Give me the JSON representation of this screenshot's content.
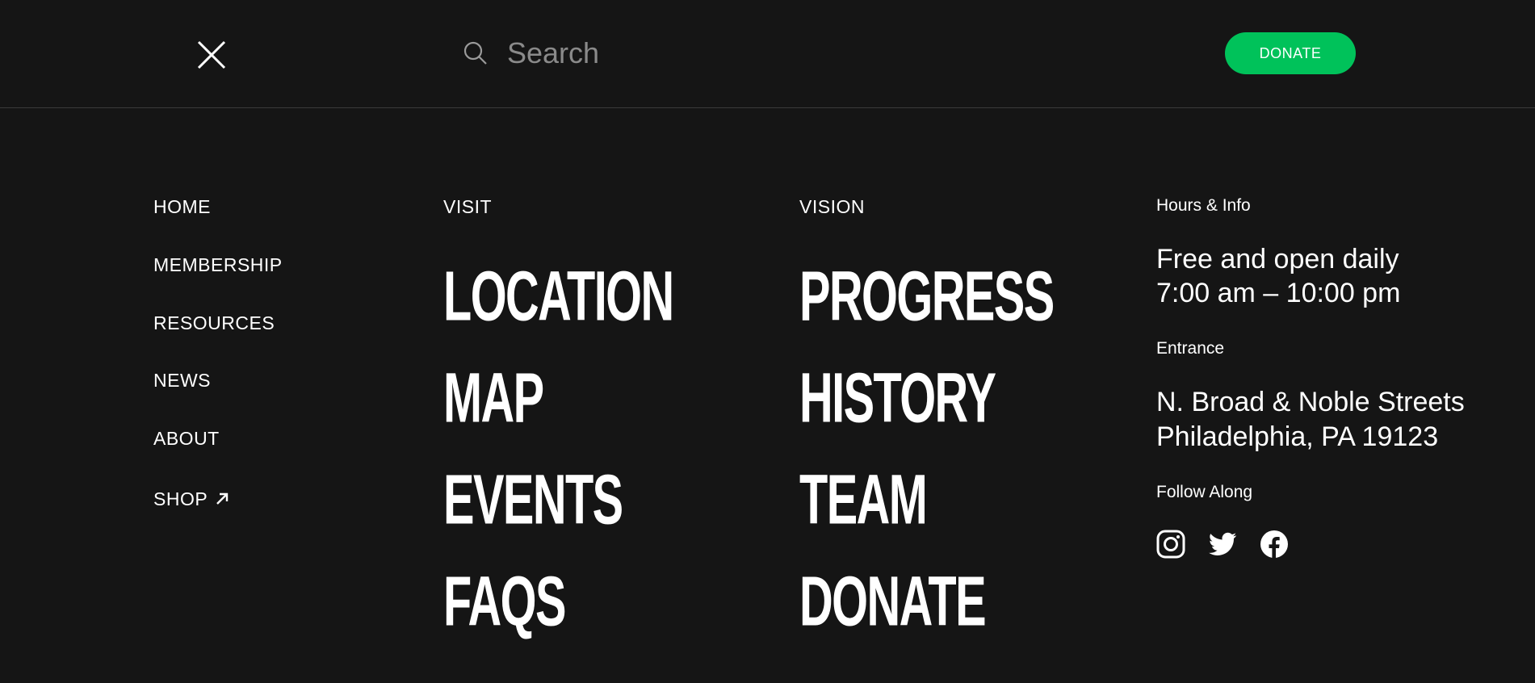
{
  "topbar": {
    "search": {
      "placeholder": "Search",
      "value": ""
    },
    "donate_label": "DONATE",
    "accent_color": "#00c25a"
  },
  "left_nav": {
    "items": [
      {
        "label": "HOME"
      },
      {
        "label": "MEMBERSHIP"
      },
      {
        "label": "RESOURCES"
      },
      {
        "label": "NEWS"
      },
      {
        "label": "ABOUT"
      },
      {
        "label": "SHOP",
        "icon": "external-arrow-icon"
      }
    ]
  },
  "visit": {
    "heading": "VISIT",
    "links": [
      "LOCATION",
      "MAP",
      "EVENTS",
      "FAQS"
    ]
  },
  "vision": {
    "heading": "VISION",
    "links": [
      "PROGRESS",
      "HISTORY",
      "TEAM",
      "DONATE"
    ]
  },
  "info": {
    "hours_heading": "Hours & Info",
    "hours_line1": "Free and open daily",
    "hours_line2": "7:00 am – 10:00 pm",
    "entrance_heading": "Entrance",
    "address_line1": "N. Broad & Noble Streets",
    "address_line2": "Philadelphia, PA 19123",
    "follow_heading": "Follow Along",
    "social_icons": [
      "instagram-icon",
      "twitter-icon",
      "facebook-icon"
    ]
  }
}
